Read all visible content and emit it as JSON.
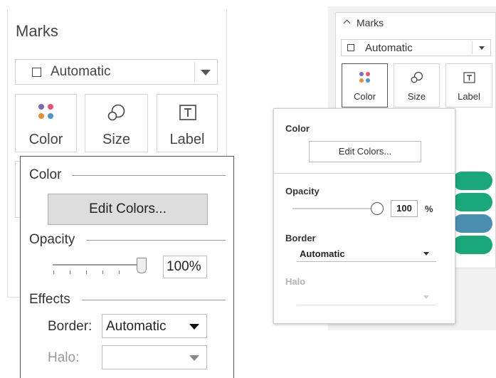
{
  "left": {
    "title": "Marks",
    "mark_type": "Automatic",
    "cards": [
      {
        "label": "Color"
      },
      {
        "label": "Size"
      },
      {
        "label": "Label"
      }
    ],
    "popup": {
      "color_heading": "Color",
      "edit_colors": "Edit Colors...",
      "opacity_heading": "Opacity",
      "opacity_value": "100%",
      "opacity_level": 1.0,
      "effects_heading": "Effects",
      "border_label": "Border:",
      "border_value": "Automatic",
      "halo_label": "Halo:",
      "halo_value": ""
    }
  },
  "right": {
    "title": "Marks",
    "mark_type": "Automatic",
    "cards": [
      {
        "label": "Color"
      },
      {
        "label": "Size"
      },
      {
        "label": "Label"
      }
    ],
    "popup": {
      "color_heading": "Color",
      "edit_colors": "Edit Colors...",
      "opacity_heading": "Opacity",
      "opacity_value": "100",
      "opacity_unit": "%",
      "opacity_level": 1.0,
      "border_heading": "Border",
      "border_value": "Automatic",
      "halo_heading": "Halo",
      "halo_value": ""
    },
    "bar_colors": [
      "#1aa77a",
      "#1aa77a",
      "#4b8fb0",
      "#1aa77a"
    ]
  },
  "palette_dots": [
    "#7b6bb3",
    "#e2566d",
    "#e58d3b",
    "#4e93c9"
  ],
  "icons": {
    "color": "color-palette-icon",
    "size": "size-icon",
    "label": "text-label-icon",
    "collapse": "chevron-up-icon",
    "mark_type": "square-mark-icon"
  }
}
